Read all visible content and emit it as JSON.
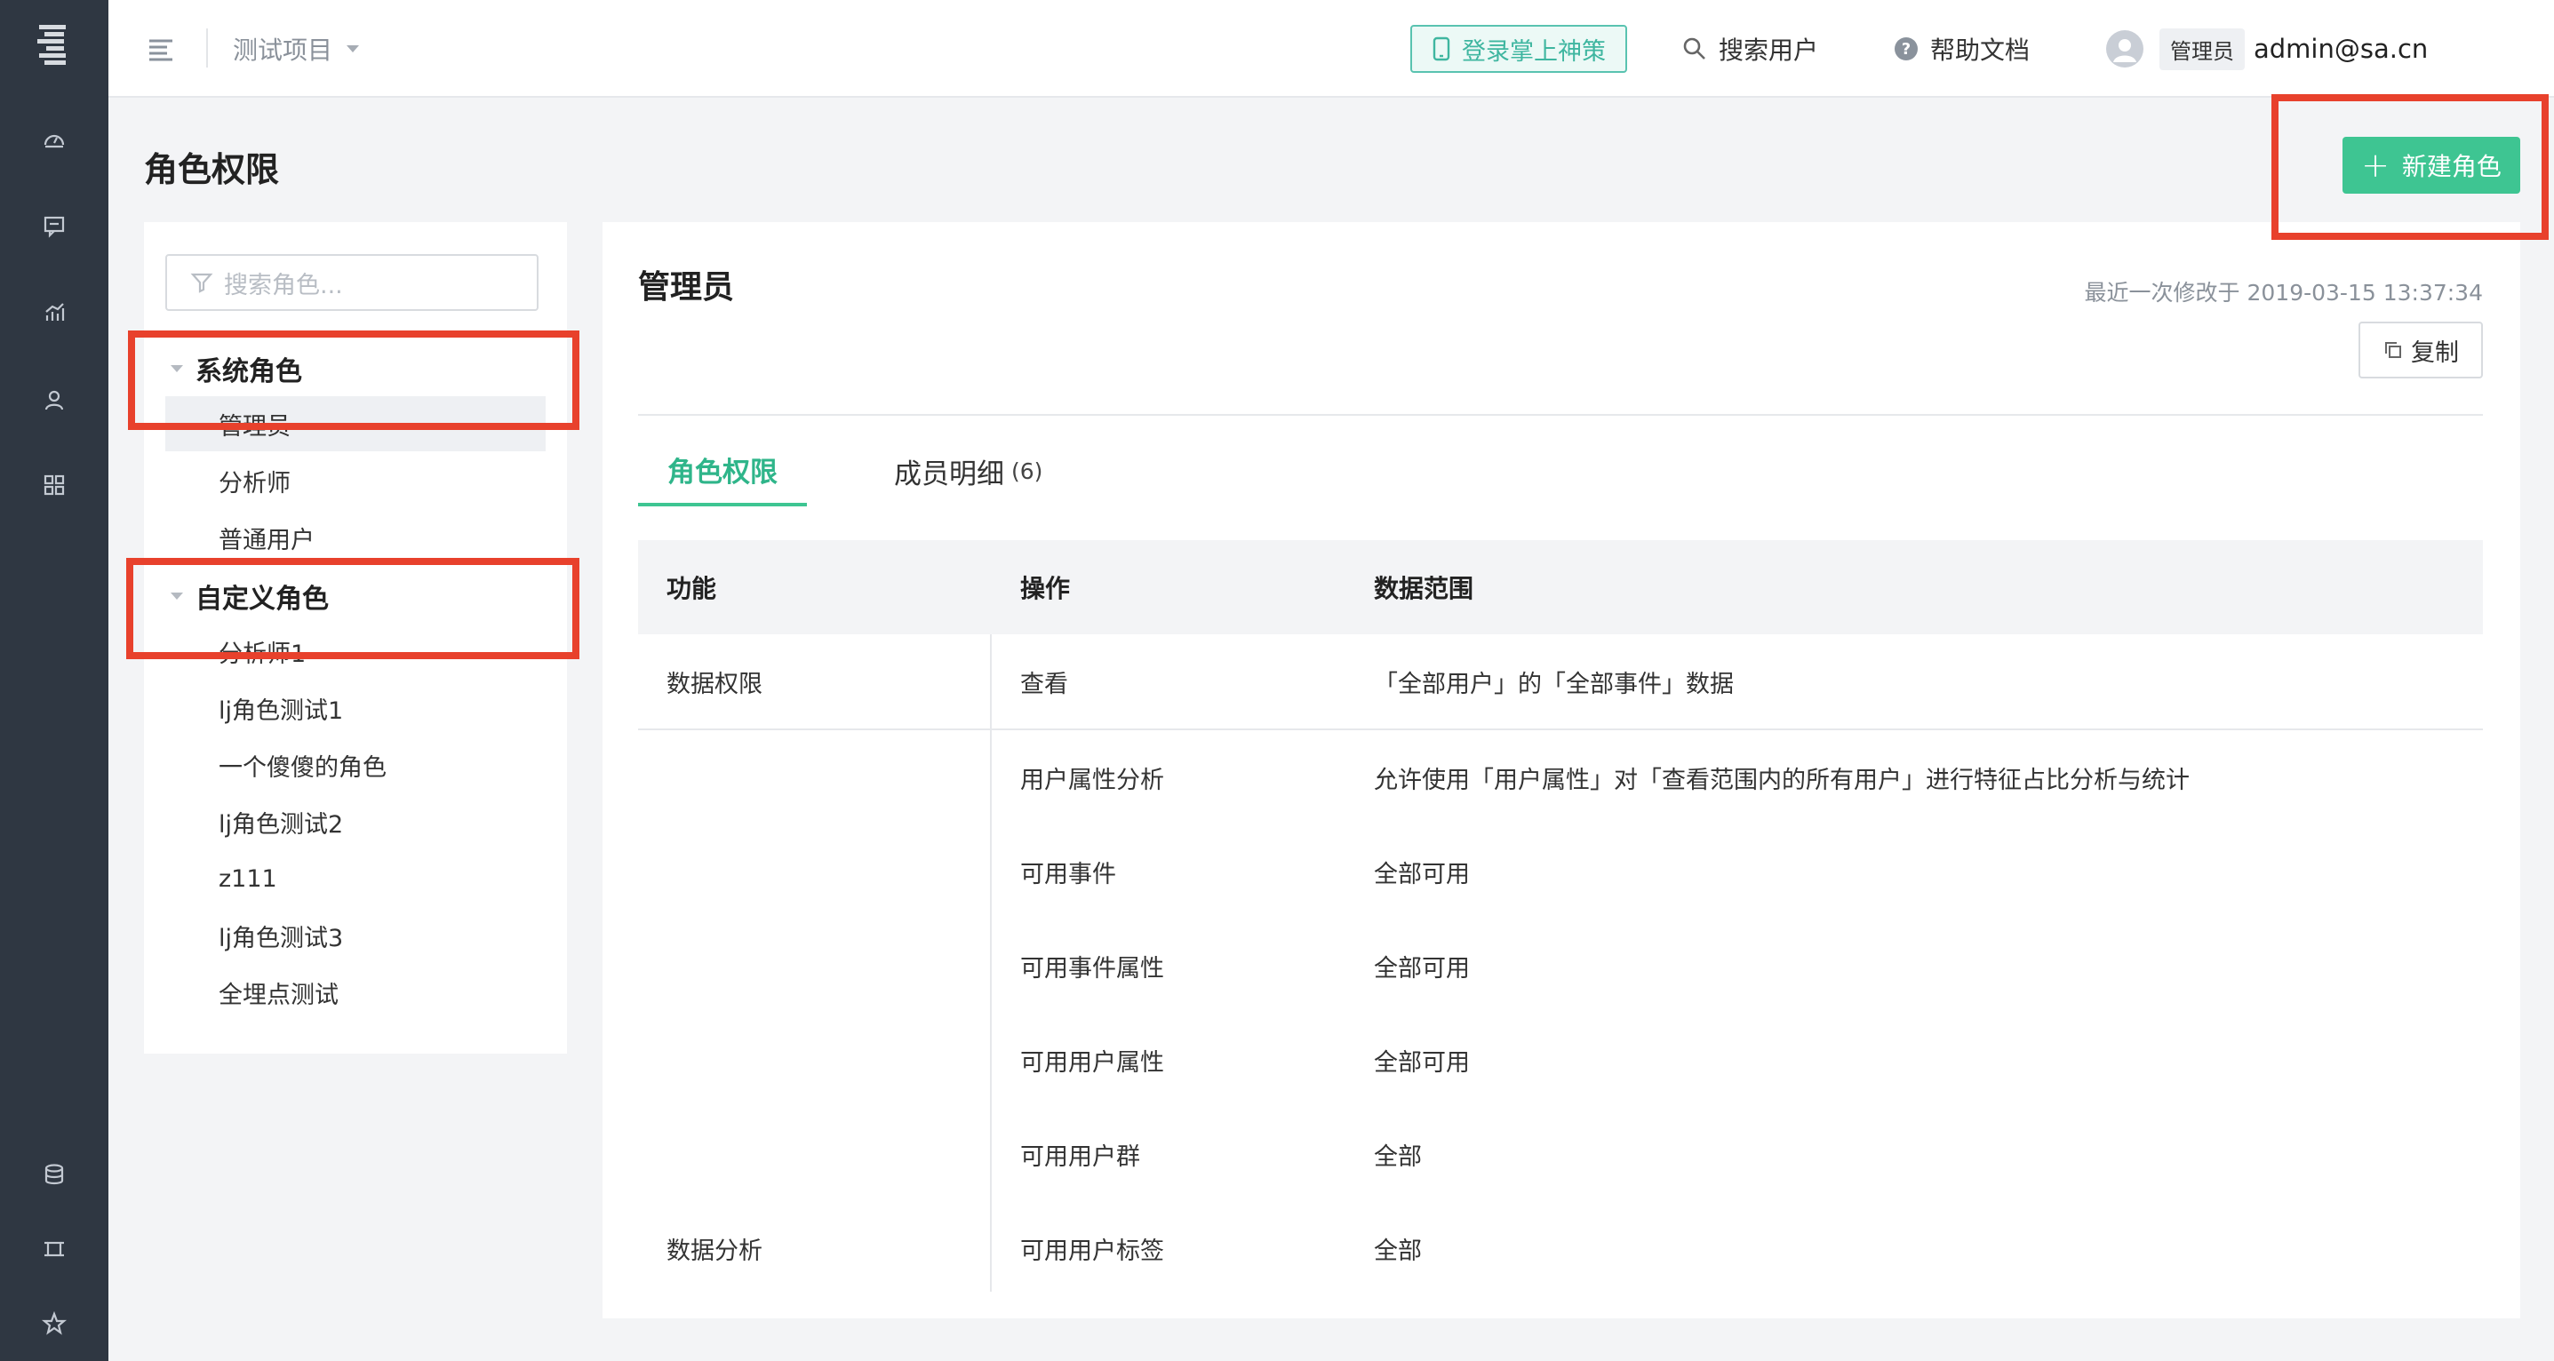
{
  "topbar": {
    "project_name": "测试项目",
    "mobile_login": "登录掌上神策",
    "search_user": "搜索用户",
    "help_docs": "帮助文档",
    "user_role_badge": "管理员",
    "user_email": "admin@sa.cn"
  },
  "page": {
    "title": "角色权限",
    "new_role_label": "新建角色"
  },
  "roles_panel": {
    "search_placeholder": "搜索角色...",
    "groups": [
      {
        "label": "系统角色",
        "items": [
          "管理员",
          "分析师",
          "普通用户"
        ]
      },
      {
        "label": "自定义角色",
        "items": [
          "分析师1",
          "lj角色测试1",
          "一个傻傻的角色",
          "lj角色测试2",
          "z111",
          "lj角色测试3",
          "全埋点测试"
        ]
      }
    ],
    "selected": "管理员"
  },
  "detail": {
    "title": "管理员",
    "last_modified": "最近一次修改于 2019-03-15 13:37:34",
    "copy_label": "复制",
    "tabs": [
      {
        "label": "角色权限",
        "active": true
      },
      {
        "label": "成员明细",
        "count": "(6)",
        "active": false
      }
    ],
    "table": {
      "headers": [
        "功能",
        "操作",
        "数据范围"
      ],
      "rows": [
        {
          "function": "数据权限",
          "operation": "查看",
          "scope": "「全部用户」的「全部事件」数据"
        },
        {
          "function": "",
          "operation": "用户属性分析",
          "scope": "允许使用「用户属性」对「查看范围内的所有用户」进行特征占比分析与统计"
        },
        {
          "function": "",
          "operation": "可用事件",
          "scope": "全部可用"
        },
        {
          "function": "",
          "operation": "可用事件属性",
          "scope": "全部可用"
        },
        {
          "function": "",
          "operation": "可用用户属性",
          "scope": "全部可用"
        },
        {
          "function": "",
          "operation": "可用用户群",
          "scope": "全部"
        },
        {
          "function": "数据分析",
          "operation": "可用用户标签",
          "scope": "全部"
        }
      ]
    }
  },
  "colors": {
    "rail_bg": "#2f3742",
    "accent_green": "#3ec592",
    "annotation_red": "#e8412c"
  },
  "icons": [
    "logo-icon",
    "dashboard-icon",
    "chat-icon",
    "analytics-icon",
    "user-icon",
    "apps-icon",
    "database-icon",
    "frame-icon",
    "star-icon",
    "menu-icon",
    "phone-icon",
    "search-icon",
    "help-icon",
    "avatar-icon",
    "filter-icon",
    "copy-icon",
    "plus-icon"
  ]
}
